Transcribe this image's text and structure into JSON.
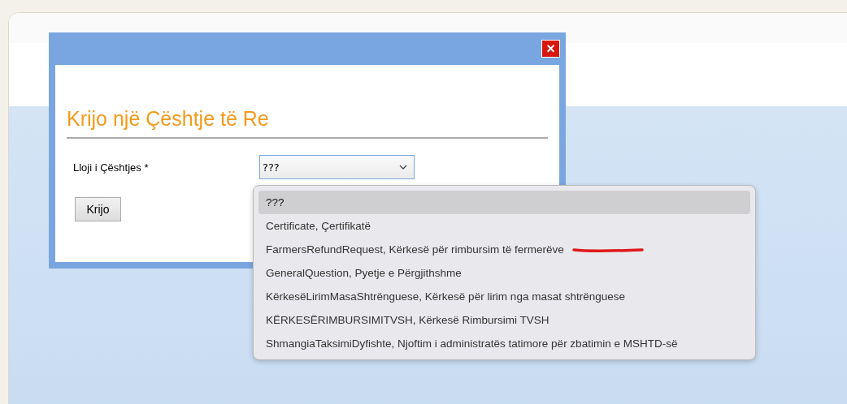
{
  "dialog": {
    "title": "Krijo një Çështje të Re",
    "close_label": "×",
    "field_label": "Lloji i Çështjes *",
    "select_value": "???",
    "submit": "Krijo"
  },
  "dropdown": {
    "options": [
      {
        "label": "???",
        "selected": true,
        "annotated": false
      },
      {
        "label": "Certificate, Çertifikatë",
        "selected": false,
        "annotated": false
      },
      {
        "label": "FarmersRefundRequest, Kërkesë për rimbursim të fermerëve",
        "selected": false,
        "annotated": true
      },
      {
        "label": "GeneralQuestion, Pyetje e Përgjithshme",
        "selected": false,
        "annotated": false
      },
      {
        "label": "KërkesëLirimMasaShtrënguese, Kërkesë për lirim nga masat shtrënguese",
        "selected": false,
        "annotated": false
      },
      {
        "label": "KËRKESËRIMBURSIMITVSH, Kërkesë Rimbursimi TVSH",
        "selected": false,
        "annotated": false
      },
      {
        "label": "ShmangiaTaksimiDyfishte, Njoftim i administratës tatimore për zbatimin e MSHTD-së",
        "selected": false,
        "annotated": false
      }
    ]
  }
}
